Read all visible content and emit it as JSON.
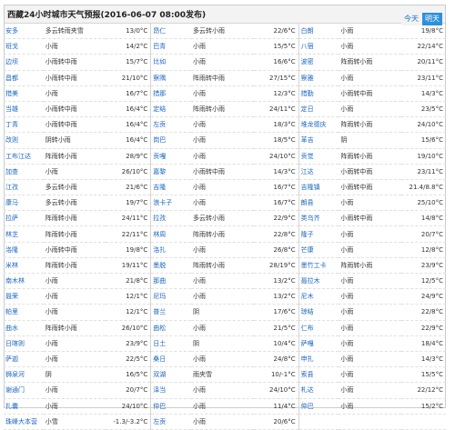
{
  "header": {
    "title": "西藏24小时城市天气预报(2016-06-07 08:00发布)",
    "tab_today": "今天",
    "tab_tomorrow": "明天"
  },
  "rows": [
    [
      [
        "安多",
        "多云转雨夹雪",
        "13/0°C"
      ],
      [
        "昂仁",
        "多云转小雨",
        "22/6°C"
      ],
      [
        "白朗",
        "小雨",
        "19/8°C"
      ]
    ],
    [
      [
        "班戈",
        "小雨",
        "14/2°C"
      ],
      [
        "巴青",
        "小雨",
        "15/5°C"
      ],
      [
        "八宿",
        "小雨",
        "22/14°C"
      ]
    ],
    [
      [
        "边坝",
        "小雨转中雨",
        "15/7°C"
      ],
      [
        "比如",
        "小雨",
        "16/6°C"
      ],
      [
        "波密",
        "阵雨转小雨",
        "20/11°C"
      ]
    ],
    [
      [
        "昌都",
        "小雨转中雨",
        "21/10°C"
      ],
      [
        "察隅",
        "阵雨转中雨",
        "27/15°C"
      ],
      [
        "察雅",
        "小雨",
        "23/11°C"
      ]
    ],
    [
      [
        "措美",
        "小雨",
        "16/7°C"
      ],
      [
        "措那",
        "小雨",
        "12/3°C"
      ],
      [
        "措勤",
        "小雨转中雨",
        "14/3°C"
      ]
    ],
    [
      [
        "当雄",
        "小雨转中雨",
        "16/4°C"
      ],
      [
        "定结",
        "阵雨转小雨",
        "24/11°C"
      ],
      [
        "定日",
        "小雨",
        "23/5°C"
      ]
    ],
    [
      [
        "丁青",
        "小雨转中雨",
        "16/4°C"
      ],
      [
        "左贡",
        "小雨",
        "18/3°C"
      ],
      [
        "堆龙德庆",
        "阵雨转小雨",
        "24/10°C"
      ]
    ],
    [
      [
        "改则",
        "阴转小雨",
        "16/4°C"
      ],
      [
        "岗巴",
        "小雨",
        "18/5°C"
      ],
      [
        "革吉",
        "阴",
        "15/6°C"
      ]
    ],
    [
      [
        "工布江达",
        "阵雨转小雨",
        "28/9°C"
      ],
      [
        "贡嘎",
        "小雨",
        "24/10°C"
      ],
      [
        "贡觉",
        "阵雨转小雨",
        "19/10°C"
      ]
    ],
    [
      [
        "加查",
        "小雨",
        "26/10°C"
      ],
      [
        "嘉黎",
        "小雨转中雨",
        "14/3°C"
      ],
      [
        "江达",
        "小雨转中雨",
        "23/11°C"
      ]
    ],
    [
      [
        "江孜",
        "多云转小雨",
        "21/6°C"
      ],
      [
        "吉隆",
        "小雨",
        "16/7°C"
      ],
      [
        "吉隆镇",
        "小雨转中雨",
        "21.4/8.8°C"
      ]
    ],
    [
      [
        "康马",
        "多云转小雨",
        "19/7°C"
      ],
      [
        "浪卡子",
        "小雨",
        "16/7°C"
      ],
      [
        "朗县",
        "小雨",
        "25/10°C"
      ]
    ],
    [
      [
        "拉萨",
        "阵雨转小雨",
        "24/11°C"
      ],
      [
        "拉孜",
        "多云转小雨",
        "22/9°C"
      ],
      [
        "类乌齐",
        "小雨转中雨",
        "14/8°C"
      ]
    ],
    [
      [
        "林芝",
        "阵雨转小雨",
        "22/11°C"
      ],
      [
        "林周",
        "阵雨转小雨",
        "22/8°C"
      ],
      [
        "隆子",
        "小雨",
        "20/7°C"
      ]
    ],
    [
      [
        "洛隆",
        "小雨转中雨",
        "19/8°C"
      ],
      [
        "洛扎",
        "小雨",
        "26/8°C"
      ],
      [
        "芒康",
        "小雨",
        "12/8°C"
      ]
    ],
    [
      [
        "米林",
        "阵雨转小雨",
        "19/11°C"
      ],
      [
        "墨脱",
        "阵雨转小雨",
        "28/19°C"
      ],
      [
        "墨竹工卡",
        "阵雨转小雨",
        "23/9°C"
      ]
    ],
    [
      [
        "南木林",
        "小雨",
        "21/8°C"
      ],
      [
        "那曲",
        "小雨",
        "13/2°C"
      ],
      [
        "聂拉木",
        "小雨",
        "12/5°C"
      ]
    ],
    [
      [
        "聂荣",
        "小雨",
        "12/1°C"
      ],
      [
        "尼玛",
        "小雨",
        "13/2°C"
      ],
      [
        "尼木",
        "小雨",
        "24/9°C"
      ]
    ],
    [
      [
        "帕里",
        "小雨",
        "12/1°C"
      ],
      [
        "普兰",
        "阴",
        "17/6°C"
      ],
      [
        "琼结",
        "小雨",
        "22/8°C"
      ]
    ],
    [
      [
        "曲水",
        "阵雨转小雨",
        "26/10°C"
      ],
      [
        "曲松",
        "小雨",
        "21/5°C"
      ],
      [
        "仁布",
        "小雨",
        "22/9°C"
      ]
    ],
    [
      [
        "日喀则",
        "小雨",
        "23/9°C"
      ],
      [
        "日土",
        "阴",
        "10/4°C"
      ],
      [
        "萨嘎",
        "小雨",
        "18/4°C"
      ]
    ],
    [
      [
        "萨迦",
        "小雨",
        "22/5°C"
      ],
      [
        "桑日",
        "小雨",
        "24/8°C"
      ],
      [
        "申扎",
        "小雨",
        "14/3°C"
      ]
    ],
    [
      [
        "狮泉河",
        "阴",
        "16/5°C"
      ],
      [
        "双湖",
        "雨夹雪",
        "10/-1°C"
      ],
      [
        "索县",
        "小雨",
        "15/5°C"
      ]
    ],
    [
      [
        "谢通门",
        "小雨",
        "20/7°C"
      ],
      [
        "泽当",
        "小雨",
        "24/10°C"
      ],
      [
        "札达",
        "小雨",
        "22/12°C"
      ]
    ],
    [
      [
        "扎囊",
        "小雨",
        "24/10°C"
      ],
      [
        "仲巴",
        "小雨",
        "11/4°C"
      ],
      [
        "仲巴",
        "小雨",
        "15/2°C"
      ]
    ],
    [
      [
        "珠峰大本营",
        "小雪",
        "-1.3/-3.2°C"
      ],
      [
        "左贡",
        "小雨",
        "20/6°C"
      ],
      [
        "",
        "",
        ""
      ]
    ]
  ]
}
